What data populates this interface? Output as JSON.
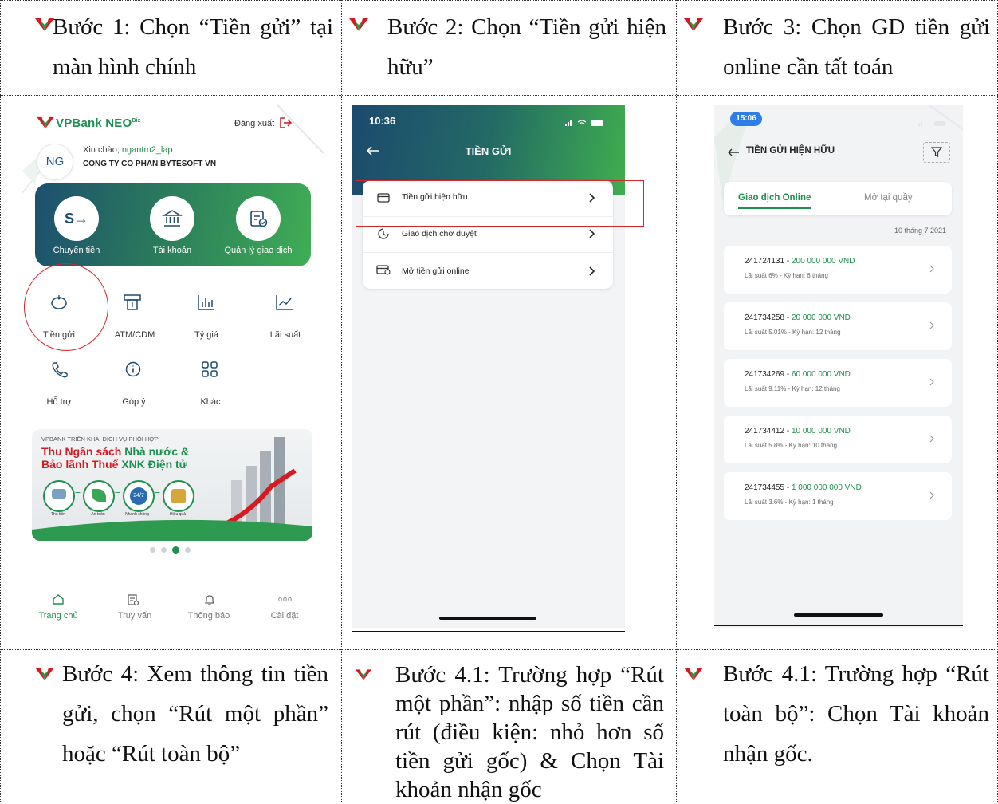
{
  "steps": {
    "s1": {
      "label": "Bước 1: Chọn “Tiền gửi” tại màn hình chính"
    },
    "s2": {
      "label": "Bước 2: Chọn “Tiền gửi hiện hữu”"
    },
    "s3": {
      "label": "Bước 3: Chọn GD tiền gửi online cần tất toán"
    },
    "s4": {
      "label": "Bước 4: Xem thông tin tiền gửi, chọn “Rút một phần” hoặc “Rút toàn bộ”"
    },
    "s5": {
      "label": "Bước 4.1: Trường hợp “Rút một phần”: nhập số tiền cần rút (điều kiện: nhỏ hơn số tiền gửi gốc) & Chọn Tài khoản nhận gốc"
    },
    "s6": {
      "label": "Bước 4.1: Trường hợp “Rút toàn bộ”: Chọn Tài khoản nhận gốc."
    }
  },
  "colors": {
    "brand_green": "#1e8f4e",
    "brand_red": "#d71920",
    "dark_blue": "#1c4a6e"
  },
  "screen1": {
    "logo": "VPBank NEO",
    "logo_sup": "Biz",
    "logout": "Đăng xuất",
    "avatar": "NG",
    "greeting_prefix": "Xin chào, ",
    "username": "ngantm2_lap",
    "company": "CONG TY CO PHAN BYTESOFT VN",
    "main_actions": [
      "Chuyển tiền",
      "Tài khoản",
      "Quản lý giao dịch"
    ],
    "grid": [
      "Tiền gửi",
      "ATM/CDM",
      "Tỷ giá",
      "Lãi suất",
      "Hỗ trợ",
      "Góp ý",
      "Khác"
    ],
    "banner": {
      "small": "VPBANK TRIỂN KHAI DỊCH VỤ PHỐI HỢP",
      "line1_red": "Thu Ngân sách",
      "line1_green": "Nhà nước &",
      "line2_red": "Bảo lãnh Thuế",
      "line2_green": "XNK Điện tử",
      "icon_labels": [
        "Thu tiền",
        "An toàn",
        "Nhanh chóng",
        "Hiệu quả"
      ]
    },
    "nav": [
      "Trang chủ",
      "Truy vấn",
      "Thông báo",
      "Cài đặt"
    ]
  },
  "screen2": {
    "time": "10:36",
    "title": "TIỀN GỬI",
    "items": [
      "Tiền gửi hiện hữu",
      "Giao dịch chờ duyệt",
      "Mở tiền gửi online"
    ]
  },
  "screen3": {
    "time": "15:06",
    "title": "TIỀN GỬI HIỆN HỮU",
    "tabs": [
      "Giao dịch Online",
      "Mở tại quầy"
    ],
    "date": "10 tháng 7 2021",
    "deposits": [
      {
        "id": "241724131",
        "amount": "200 000 000 VND",
        "detail": "Lãi suất 6% - Kỳ hạn: 6 tháng"
      },
      {
        "id": "241734258",
        "amount": "20 000 000 VND",
        "detail": "Lãi suất 5.01% - Kỳ hạn: 12 tháng"
      },
      {
        "id": "241734269",
        "amount": "60 000 000 VND",
        "detail": "Lãi suất 9.11% - Kỳ hạn: 12 tháng"
      },
      {
        "id": "241734412",
        "amount": "10 000 000 VND",
        "detail": "Lãi suất 5.8% - Kỳ hạn: 10 tháng"
      },
      {
        "id": "241734455",
        "amount": "1 000 000 000 VND",
        "detail": "Lãi suất 3.6% - Kỳ hạn: 1 tháng"
      }
    ]
  }
}
